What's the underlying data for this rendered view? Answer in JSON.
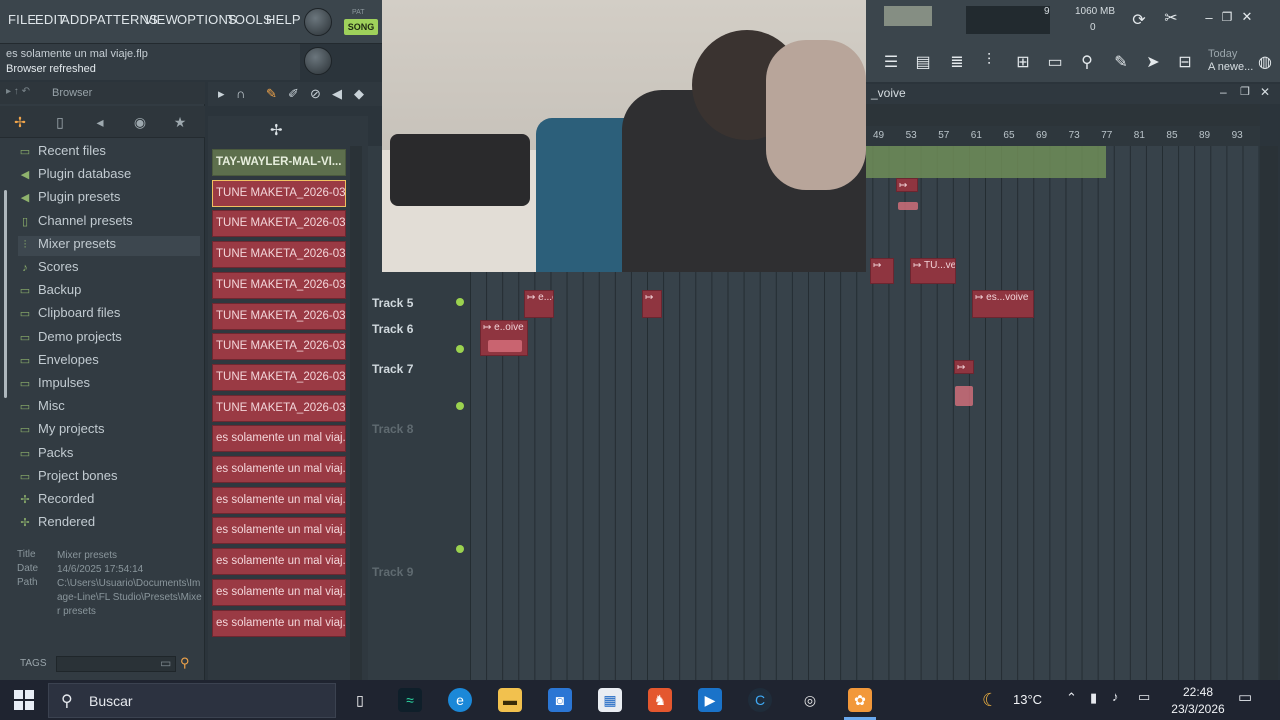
{
  "menu": [
    "FILE",
    "EDIT",
    "ADD",
    "PATTERNS",
    "VIEW",
    "OPTIONS",
    "TOOLS",
    "HELP"
  ],
  "hint": {
    "line1": "es solamente un mal viaje.flp",
    "line2": "Browser refreshed"
  },
  "transport": {
    "mode_label": "SONG",
    "pat_label": "PAT"
  },
  "monitor": {
    "value": "9",
    "memory": "1060 MB",
    "cpu": "0"
  },
  "news": {
    "line1": "Today",
    "line2": "A newe..."
  },
  "browser": {
    "title": "Browser",
    "items": [
      {
        "label": "Recent files",
        "icon": "folder-icon"
      },
      {
        "label": "Plugin database",
        "icon": "plug-icon"
      },
      {
        "label": "Plugin presets",
        "icon": "plug-icon"
      },
      {
        "label": "Channel presets",
        "icon": "square-icon"
      },
      {
        "label": "Mixer presets",
        "icon": "mixer-icon"
      },
      {
        "label": "Scores",
        "icon": "note-icon"
      },
      {
        "label": "Backup",
        "icon": "folder-icon"
      },
      {
        "label": "Clipboard files",
        "icon": "folder-icon"
      },
      {
        "label": "Demo projects",
        "icon": "folder-icon"
      },
      {
        "label": "Envelopes",
        "icon": "folder-icon"
      },
      {
        "label": "Impulses",
        "icon": "folder-icon"
      },
      {
        "label": "Misc",
        "icon": "folder-icon"
      },
      {
        "label": "My projects",
        "icon": "folder-icon"
      },
      {
        "label": "Packs",
        "icon": "folder-icon"
      },
      {
        "label": "Project bones",
        "icon": "folder-icon"
      },
      {
        "label": "Recorded",
        "icon": "plus-icon"
      },
      {
        "label": "Rendered",
        "icon": "plus-icon"
      }
    ],
    "info": {
      "title_label": "Title",
      "title": "Mixer presets",
      "date_label": "Date",
      "date": "14/6/2025 17:54:14",
      "path_label": "Path",
      "path": "C:\\Users\\Usuario\\Documents\\Image-Line\\FL Studio\\Presets\\Mixer presets"
    },
    "tags_label": "TAGS"
  },
  "clips": [
    "TAY-WAYLER-MAL-VI...",
    "TUNE MAKETA_2026-03-...",
    "TUNE MAKETA_2026-03-...",
    "TUNE MAKETA_2026-03-...",
    "TUNE MAKETA_2026-03-...",
    "TUNE MAKETA_2026-03-...",
    "TUNE MAKETA_2026-03-...",
    "TUNE MAKETA_2026-03-...",
    "TUNE MAKETA_2026-03-...",
    "es solamente un mal viaj...",
    "es solamente un mal viaj...",
    "es solamente un mal viaj...",
    "es solamente un mal viaj...",
    "es solamente un mal viaj...",
    "es solamente un mal viaj...",
    "es solamente un mal viaj..."
  ],
  "playlist": {
    "title": "_voive",
    "ruler": [
      "49",
      "53",
      "57",
      "61",
      "65",
      "69",
      "73",
      "77",
      "81",
      "85",
      "89",
      "93"
    ],
    "tracks": [
      "Track 5",
      "Track 6",
      "Track 7",
      "Track 8",
      "Track 9"
    ],
    "clip_labels": {
      "a": "e...e",
      "b": "e..oive",
      "c": "TU...ve",
      "d": "es...voive"
    }
  },
  "taskbar": {
    "search": "Buscar",
    "temperature": "13°C",
    "time": "22:48",
    "date": "23/3/2026"
  }
}
